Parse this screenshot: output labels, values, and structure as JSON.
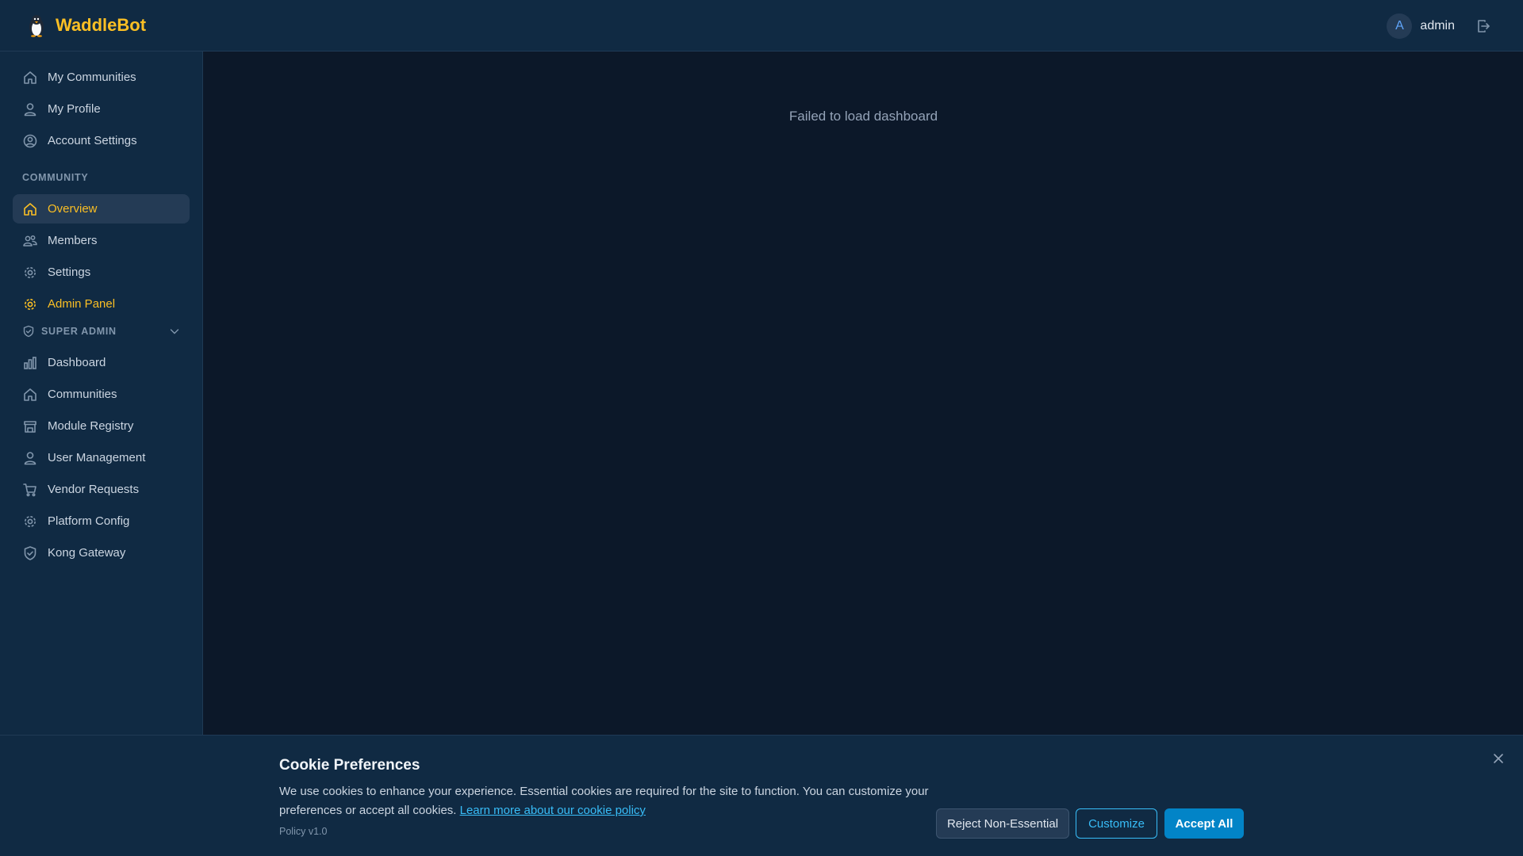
{
  "header": {
    "app_name": "WaddleBot",
    "user": {
      "initial": "A",
      "name": "admin"
    }
  },
  "sidebar": {
    "top_items": [
      {
        "label": "My Communities",
        "icon": "home-icon"
      },
      {
        "label": "My Profile",
        "icon": "user-icon"
      },
      {
        "label": "Account Settings",
        "icon": "user-circle-icon"
      }
    ],
    "community_label": "COMMUNITY",
    "community_items": [
      {
        "label": "Overview",
        "icon": "home-icon",
        "active": true
      },
      {
        "label": "Members",
        "icon": "users-icon"
      },
      {
        "label": "Settings",
        "icon": "gear-icon"
      },
      {
        "label": "Admin Panel",
        "icon": "gear-icon"
      }
    ],
    "super_admin_label": "SUPER ADMIN",
    "super_admin_items": [
      {
        "label": "Dashboard",
        "icon": "bar-chart-icon"
      },
      {
        "label": "Communities",
        "icon": "home-icon"
      },
      {
        "label": "Module Registry",
        "icon": "store-icon"
      },
      {
        "label": "User Management",
        "icon": "user-icon"
      },
      {
        "label": "Vendor Requests",
        "icon": "cart-icon"
      },
      {
        "label": "Platform Config",
        "icon": "gear-icon"
      },
      {
        "label": "Kong Gateway",
        "icon": "shield-check-icon"
      }
    ]
  },
  "main": {
    "error_message": "Failed to load dashboard"
  },
  "cookie_banner": {
    "title": "Cookie Preferences",
    "text": "We use cookies to enhance your experience. Essential cookies are required for the site to function. You can customize your preferences or accept all cookies.",
    "link_text": "Learn more about our cookie policy",
    "policy_version": "Policy v1.0",
    "reject_label": "Reject Non-Essential",
    "customize_label": "Customize",
    "accept_label": "Accept All"
  },
  "colors": {
    "background": "#0c1829",
    "panel": "#102a43",
    "accent": "#fbbf24",
    "link": "#38bdf8",
    "primary_button": "#0284c7"
  }
}
